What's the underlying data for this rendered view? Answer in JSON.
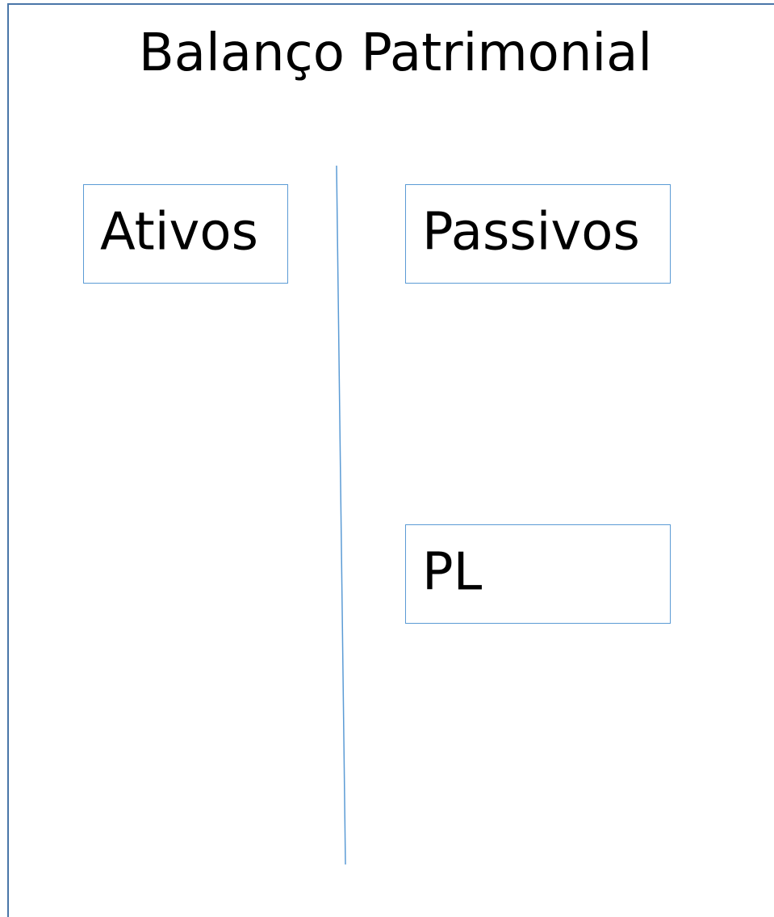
{
  "title": "Balanço Patrimonial",
  "boxes": {
    "ativos": "Ativos",
    "passivos": "Passivos",
    "pl": "PL"
  },
  "colors": {
    "frame_border": "#4a76a8",
    "box_border": "#5b9bd5",
    "divider": "#5b9bd5",
    "text": "#000000",
    "background": "#ffffff"
  }
}
